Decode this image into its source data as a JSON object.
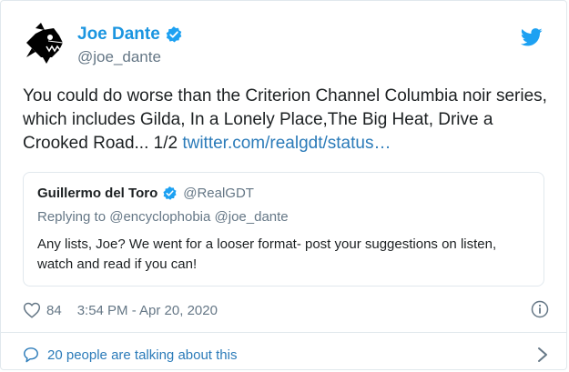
{
  "author": {
    "display_name": "Joe Dante",
    "handle": "@joe_dante",
    "avatar_icon": "piranha-avatar-icon",
    "verified_icon": "verified-badge-icon"
  },
  "tweet": {
    "text": "You could do worse than the Criterion Channel Columbia noir series, which includes Gilda, In a Lonely Place,The Big Heat, Drive a Crooked Road... 1/2 ",
    "link_text": "twitter.com/realgdt/status…"
  },
  "quoted": {
    "display_name": "Guillermo del Toro",
    "handle": "@RealGDT",
    "replying_to": "Replying to @encyclophobia @joe_dante",
    "text": "Any lists, Joe? We went for a looser format-  post your suggestions on listen, watch and read if you can!"
  },
  "meta": {
    "likes": "84",
    "timestamp": "3:54 PM - Apr 20, 2020"
  },
  "footer": {
    "talking": "20 people are talking about this"
  },
  "colors": {
    "accent": "#1b95e0",
    "link": "#2b7bb9",
    "muted": "#657786",
    "border": "#e1e8ed"
  }
}
